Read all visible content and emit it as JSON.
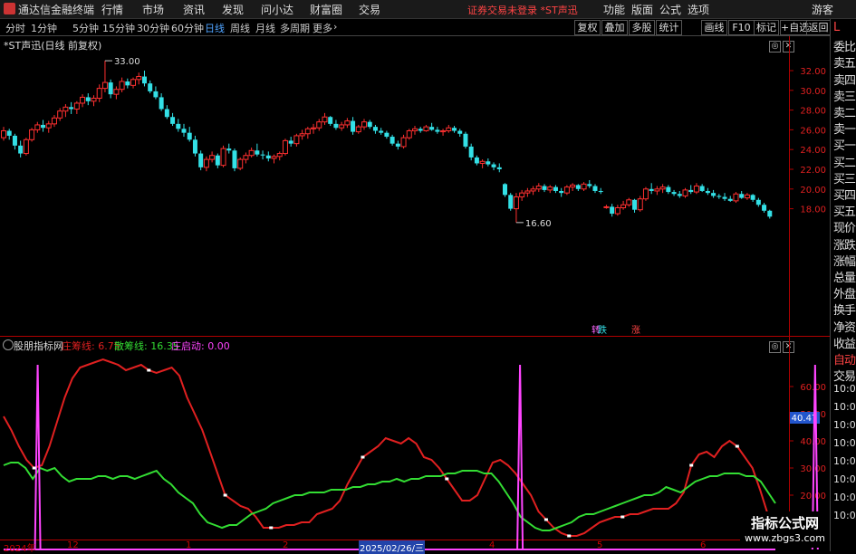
{
  "menubar": {
    "logo": "通达信金融终端",
    "items": [
      "行情",
      "市场",
      "资讯",
      "发现",
      "问小达",
      "财富圈",
      "交易"
    ],
    "status": "证券交易未登录  *ST声迅",
    "right_items": [
      "功能",
      "版面",
      "公式",
      "选项"
    ],
    "user": "游客"
  },
  "toolbar": {
    "periods": [
      "分时",
      "1分钟",
      "5分钟",
      "15分钟",
      "30分钟",
      "60分钟",
      "日线",
      "周线",
      "月线",
      "多周期",
      "更多"
    ],
    "active_period": "日线",
    "buttons": [
      "复权",
      "叠加",
      "多股",
      "统计",
      "画线",
      "F10",
      "标记",
      "+自选",
      "返回"
    ]
  },
  "main_chart": {
    "title": "*ST声迅(日线 前复权)",
    "high_label": "33.00",
    "low_label": "16.60",
    "y_ticks": [
      "32.00",
      "30.00",
      "28.00",
      "26.00",
      "24.00",
      "22.00",
      "20.00",
      "18.00"
    ],
    "markers": [
      "转",
      "跌",
      "涨"
    ]
  },
  "indicator": {
    "name": "股朋指标网",
    "line1": "庄筹线: 6.75",
    "line2": "散筹线: 16.35",
    "line3": "庄启动: 0.00",
    "cursor_value": "40.47",
    "y_ticks": [
      "60.00",
      "50.00",
      "40.00",
      "30.00",
      "20.00",
      "10.00"
    ],
    "colors": {
      "zhuang": "#e02020",
      "san": "#33dd33",
      "qidong": "#ff44ff"
    }
  },
  "x_axis": {
    "labels": [
      "2024年",
      "12",
      "1",
      "2",
      "2025/02/26/三",
      "4",
      "5",
      "6"
    ]
  },
  "side_panel": {
    "items": [
      "L",
      "委比",
      "卖五",
      "卖四",
      "卖三",
      "卖二",
      "卖一",
      "买一",
      "买二",
      "买三",
      "买四",
      "买五",
      "现价",
      "涨跌",
      "涨幅",
      "总量",
      "外盘",
      "换手",
      "净资",
      "收益",
      "自动",
      "交易"
    ],
    "times": [
      "10:02",
      "10:02",
      "10:02",
      "10:02",
      "10:03",
      "10:03",
      "10:04",
      "10:04"
    ]
  },
  "watermark": {
    "title": "指标公式网",
    "url": "www.zbgs3.com"
  },
  "chart_data": [
    {
      "type": "candlestick",
      "title": "*ST声迅(日线 前复权)",
      "ylim": [
        16.6,
        33.0
      ],
      "high": 33.0,
      "low": 16.6,
      "ohlc": [
        [
          25.2,
          26.3,
          24.9,
          25.9
        ],
        [
          25.9,
          26.1,
          25.0,
          25.4
        ],
        [
          25.4,
          25.6,
          24.0,
          24.4
        ],
        [
          24.4,
          24.9,
          23.2,
          23.6
        ],
        [
          23.6,
          25.2,
          23.4,
          25.0
        ],
        [
          25.0,
          26.2,
          24.8,
          26.0
        ],
        [
          26.0,
          26.8,
          25.7,
          26.5
        ],
        [
          26.5,
          27.0,
          25.8,
          26.2
        ],
        [
          26.2,
          26.9,
          25.7,
          26.6
        ],
        [
          26.6,
          27.5,
          26.3,
          27.2
        ],
        [
          27.2,
          28.2,
          26.9,
          27.9
        ],
        [
          27.9,
          28.6,
          27.3,
          28.3
        ],
        [
          28.3,
          28.8,
          27.6,
          28.1
        ],
        [
          28.1,
          28.9,
          27.6,
          28.7
        ],
        [
          28.7,
          29.6,
          28.3,
          29.3
        ],
        [
          29.3,
          29.7,
          28.5,
          28.9
        ],
        [
          28.9,
          29.5,
          28.4,
          29.2
        ],
        [
          29.2,
          30.6,
          28.8,
          30.2
        ],
        [
          30.2,
          33.0,
          29.8,
          30.8
        ],
        [
          30.8,
          31.1,
          29.2,
          29.6
        ],
        [
          29.6,
          30.4,
          29.1,
          30.1
        ],
        [
          30.1,
          31.3,
          29.8,
          30.9
        ],
        [
          30.9,
          31.2,
          30.2,
          30.5
        ],
        [
          30.5,
          31.3,
          30.2,
          31.1
        ],
        [
          31.1,
          31.8,
          30.6,
          31.4
        ],
        [
          31.4,
          32.0,
          30.4,
          30.7
        ],
        [
          30.7,
          31.0,
          29.7,
          29.9
        ],
        [
          29.9,
          30.4,
          29.1,
          29.3
        ],
        [
          29.3,
          29.7,
          27.9,
          28.1
        ],
        [
          28.1,
          28.5,
          27.1,
          27.3
        ],
        [
          27.3,
          27.7,
          26.4,
          26.6
        ],
        [
          26.6,
          27.1,
          25.8,
          26.1
        ],
        [
          26.1,
          26.6,
          25.3,
          25.7
        ],
        [
          25.7,
          26.3,
          24.8,
          25.0
        ],
        [
          25.0,
          25.4,
          23.3,
          23.6
        ],
        [
          23.6,
          23.9,
          21.9,
          22.2
        ],
        [
          22.2,
          23.3,
          21.8,
          23.0
        ],
        [
          23.0,
          23.8,
          22.7,
          23.4
        ],
        [
          23.4,
          23.6,
          22.1,
          22.4
        ],
        [
          22.4,
          24.4,
          22.2,
          24.1
        ],
        [
          24.1,
          24.6,
          23.6,
          23.9
        ],
        [
          23.9,
          24.1,
          21.8,
          22.1
        ],
        [
          22.1,
          23.2,
          21.9,
          23.0
        ],
        [
          23.0,
          23.7,
          22.6,
          23.4
        ],
        [
          23.4,
          24.2,
          23.2,
          23.9
        ],
        [
          23.9,
          24.6,
          23.3,
          23.5
        ],
        [
          23.5,
          23.9,
          23.0,
          23.4
        ],
        [
          23.4,
          23.8,
          22.8,
          23.1
        ],
        [
          23.1,
          23.5,
          22.6,
          23.3
        ],
        [
          23.3,
          23.8,
          22.9,
          23.6
        ],
        [
          23.6,
          25.1,
          23.4,
          24.9
        ],
        [
          24.9,
          25.3,
          24.3,
          24.6
        ],
        [
          24.6,
          25.6,
          24.3,
          25.4
        ],
        [
          25.4,
          26.0,
          25.0,
          25.6
        ],
        [
          25.6,
          26.3,
          25.1,
          26.1
        ],
        [
          26.1,
          26.6,
          25.6,
          26.2
        ],
        [
          26.2,
          27.1,
          25.9,
          26.8
        ],
        [
          26.8,
          27.7,
          26.5,
          27.3
        ],
        [
          27.3,
          27.4,
          26.4,
          26.6
        ],
        [
          26.6,
          27.0,
          26.0,
          26.2
        ],
        [
          26.2,
          26.8,
          25.9,
          26.5
        ],
        [
          26.5,
          27.2,
          26.2,
          26.9
        ],
        [
          26.9,
          27.3,
          25.5,
          25.8
        ],
        [
          25.8,
          26.5,
          25.6,
          26.3
        ],
        [
          26.3,
          27.1,
          26.0,
          26.8
        ],
        [
          26.8,
          27.0,
          26.1,
          26.3
        ],
        [
          26.3,
          26.5,
          25.6,
          25.9
        ],
        [
          25.9,
          26.2,
          25.5,
          25.7
        ],
        [
          25.7,
          25.9,
          25.1,
          25.3
        ],
        [
          25.3,
          25.5,
          24.4,
          24.6
        ],
        [
          24.6,
          24.9,
          24.0,
          24.3
        ],
        [
          24.3,
          25.5,
          24.1,
          25.2
        ],
        [
          25.2,
          26.1,
          25.0,
          25.9
        ],
        [
          25.9,
          26.4,
          25.5,
          26.1
        ],
        [
          26.1,
          26.3,
          25.7,
          25.9
        ],
        [
          25.9,
          26.5,
          25.8,
          26.3
        ],
        [
          26.3,
          26.7,
          25.9,
          26.0
        ],
        [
          26.0,
          26.3,
          25.6,
          25.8
        ],
        [
          25.8,
          26.1,
          25.4,
          25.9
        ],
        [
          25.9,
          26.5,
          25.7,
          26.2
        ],
        [
          26.2,
          26.4,
          25.7,
          25.9
        ],
        [
          25.9,
          26.1,
          25.3,
          25.6
        ],
        [
          25.6,
          25.8,
          24.1,
          24.3
        ],
        [
          24.3,
          24.6,
          22.9,
          23.2
        ],
        [
          23.2,
          23.4,
          22.4,
          22.6
        ],
        [
          22.6,
          23.0,
          22.1,
          22.8
        ],
        [
          22.8,
          23.1,
          22.3,
          22.5
        ],
        [
          22.5,
          22.7,
          21.9,
          22.2
        ],
        [
          22.2,
          22.6,
          21.7,
          22.0
        ],
        [
          20.5,
          20.6,
          19.2,
          19.4
        ],
        [
          19.4,
          19.6,
          17.8,
          18.0
        ],
        [
          18.0,
          19.6,
          16.6,
          19.2
        ],
        [
          19.2,
          19.9,
          18.8,
          19.6
        ],
        [
          19.6,
          20.1,
          19.2,
          19.8
        ],
        [
          19.8,
          20.3,
          19.4,
          20.0
        ],
        [
          20.0,
          20.6,
          19.7,
          20.3
        ],
        [
          20.3,
          20.5,
          19.7,
          19.9
        ],
        [
          19.9,
          20.4,
          19.6,
          20.2
        ],
        [
          20.2,
          20.4,
          19.6,
          19.8
        ],
        [
          19.8,
          20.1,
          19.2,
          19.6
        ],
        [
          19.6,
          20.4,
          19.4,
          20.2
        ],
        [
          20.2,
          20.6,
          19.8,
          20.4
        ],
        [
          20.4,
          20.5,
          19.8,
          20.0
        ],
        [
          20.0,
          20.7,
          19.8,
          20.5
        ],
        [
          20.5,
          20.9,
          20.1,
          20.3
        ],
        [
          20.3,
          20.5,
          19.6,
          19.8
        ],
        [
          19.8,
          20.1,
          19.5,
          19.7
        ],
        [
          18.2,
          18.4,
          18.0,
          18.2
        ],
        [
          18.2,
          18.5,
          17.2,
          17.5
        ],
        [
          17.5,
          18.4,
          17.3,
          18.1
        ],
        [
          18.1,
          18.8,
          17.9,
          18.4
        ],
        [
          18.4,
          19.1,
          18.2,
          18.9
        ],
        [
          18.9,
          19.0,
          17.6,
          17.9
        ],
        [
          17.9,
          19.3,
          17.7,
          19.0
        ],
        [
          19.0,
          20.2,
          18.8,
          20.0
        ],
        [
          20.0,
          20.6,
          19.5,
          19.8
        ],
        [
          19.8,
          20.3,
          19.4,
          20.0
        ],
        [
          20.0,
          20.5,
          19.6,
          20.2
        ],
        [
          20.2,
          20.4,
          19.5,
          19.7
        ],
        [
          19.7,
          19.9,
          19.3,
          19.5
        ],
        [
          19.5,
          19.8,
          19.1,
          19.3
        ],
        [
          19.3,
          20.1,
          19.1,
          19.9
        ],
        [
          19.9,
          20.4,
          19.5,
          19.7
        ],
        [
          19.7,
          20.6,
          19.5,
          20.3
        ],
        [
          20.3,
          20.5,
          19.7,
          19.8
        ],
        [
          19.8,
          20.1,
          19.4,
          19.6
        ],
        [
          19.6,
          19.9,
          19.1,
          19.3
        ],
        [
          19.3,
          19.5,
          19.0,
          19.2
        ],
        [
          19.2,
          19.6,
          18.8,
          19.0
        ],
        [
          19.0,
          19.3,
          18.7,
          18.8
        ],
        [
          18.8,
          19.7,
          18.6,
          19.5
        ],
        [
          19.5,
          19.8,
          19.0,
          19.1
        ],
        [
          19.1,
          19.6,
          18.9,
          19.4
        ],
        [
          19.4,
          19.5,
          18.7,
          18.9
        ],
        [
          18.9,
          19.1,
          18.2,
          18.4
        ],
        [
          18.4,
          18.6,
          17.6,
          17.8
        ],
        [
          17.8,
          17.9,
          17.0,
          17.2
        ]
      ]
    },
    {
      "type": "line",
      "title": "股朋指标网",
      "ylim": [
        5,
        70
      ],
      "series": [
        {
          "name": "庄筹线",
          "color": "#e02020",
          "values": [
            49,
            44,
            38,
            33,
            30,
            31,
            38,
            47,
            56,
            63,
            67,
            68,
            69,
            70,
            69,
            68,
            66,
            67,
            68,
            66,
            65,
            66,
            67,
            64,
            56,
            50,
            44,
            36,
            28,
            20,
            18,
            16,
            15,
            12,
            8,
            8,
            8,
            9,
            9,
            10,
            10,
            13,
            14,
            15,
            18,
            24,
            29,
            34,
            36,
            38,
            41,
            40,
            39,
            41,
            39,
            34,
            33,
            30,
            26,
            22,
            18,
            18,
            20,
            26,
            32,
            33,
            31,
            28,
            24,
            20,
            14,
            11,
            8,
            6,
            5,
            5,
            6,
            8,
            10,
            11,
            12,
            12,
            13,
            13,
            14,
            15,
            15,
            15,
            17,
            21,
            31,
            35,
            36,
            34,
            38,
            40,
            38,
            34,
            30,
            22,
            13,
            10
          ]
        },
        {
          "name": "散筹线",
          "color": "#33dd33",
          "values": [
            31,
            32,
            32,
            30,
            26,
            30,
            29,
            30,
            27,
            25,
            26,
            26,
            26,
            27,
            27,
            26,
            27,
            27,
            26,
            27,
            28,
            29,
            26,
            24,
            21,
            19,
            17,
            13,
            10,
            9,
            8,
            9,
            9,
            11,
            13,
            14,
            15,
            17,
            18,
            19,
            20,
            20,
            21,
            21,
            21,
            22,
            22,
            22,
            23,
            23,
            24,
            24,
            25,
            25,
            26,
            25,
            26,
            26,
            27,
            27,
            27,
            28,
            28,
            29,
            29,
            29,
            28,
            28,
            25,
            21,
            17,
            12,
            10,
            8,
            7,
            7,
            8,
            9,
            10,
            12,
            13,
            13,
            14,
            15,
            16,
            17,
            18,
            19,
            20,
            20,
            21,
            23,
            22,
            21,
            23,
            25,
            26,
            27,
            27,
            28,
            28,
            28,
            27,
            27,
            25,
            21,
            17
          ]
        },
        {
          "name": "庄启动",
          "color": "#ff44ff",
          "values": [
            0,
            0,
            0,
            0,
            0,
            0,
            0,
            0,
            0,
            0,
            0,
            0,
            0,
            0,
            0,
            0,
            0,
            0,
            0,
            0,
            0,
            0,
            0,
            0,
            0,
            0,
            0,
            0,
            0,
            0,
            0,
            0,
            0,
            0,
            0,
            0,
            0,
            0,
            0,
            0,
            0,
            0,
            0,
            0,
            0,
            0,
            0,
            0,
            0,
            0,
            0,
            0,
            0,
            0,
            0,
            0,
            0,
            0,
            0,
            0,
            0,
            0,
            0,
            0,
            0,
            0,
            0,
            0,
            0,
            0,
            0,
            0,
            0,
            0,
            0,
            0,
            0,
            0,
            0,
            0,
            0,
            0,
            0,
            0,
            0,
            0,
            0,
            0,
            0,
            0,
            0,
            0,
            0,
            0,
            0,
            0,
            0,
            0,
            0,
            0,
            0,
            0
          ]
        }
      ],
      "spikes": [
        {
          "x_index": 6,
          "value": 68
        },
        {
          "x_index": 91,
          "value": 68
        },
        {
          "x_index": 143,
          "value": 68
        },
        {
          "x_index": 166,
          "value": 68
        }
      ]
    }
  ]
}
